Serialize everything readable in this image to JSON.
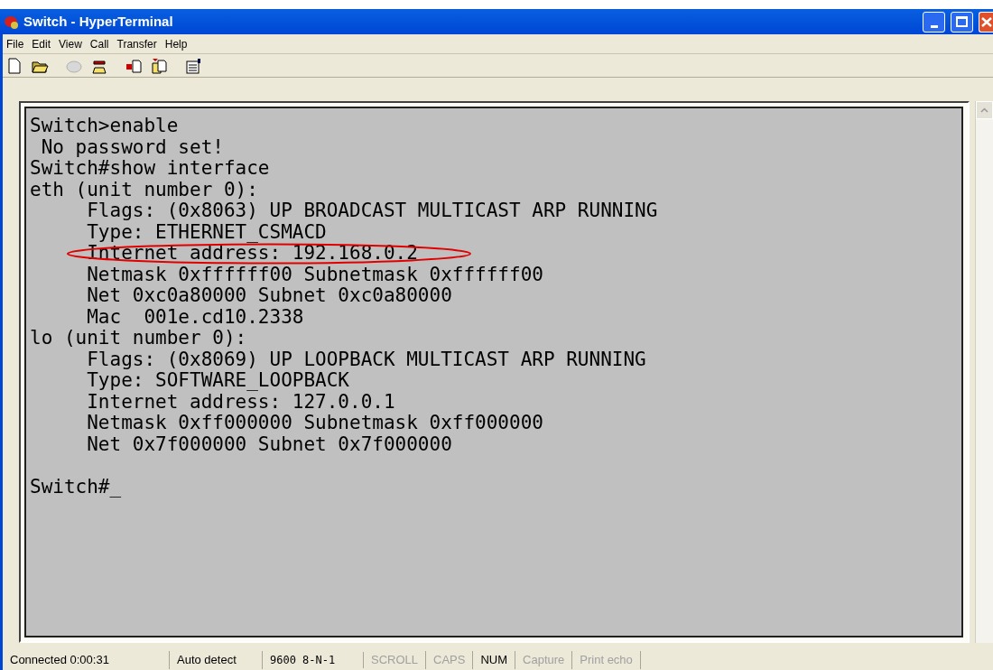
{
  "window": {
    "title": "Switch - HyperTerminal"
  },
  "menu": [
    "File",
    "Edit",
    "View",
    "Call",
    "Transfer",
    "Help"
  ],
  "toolbar": [
    {
      "kind": "new",
      "disabled": false
    },
    {
      "kind": "open",
      "disabled": false
    },
    {
      "kind": "phone",
      "disabled": true
    },
    {
      "kind": "dial",
      "disabled": false
    },
    {
      "kind": "send",
      "disabled": false
    },
    {
      "kind": "receive",
      "disabled": false
    },
    {
      "kind": "properties",
      "disabled": false
    }
  ],
  "terminal": {
    "lines": [
      {
        "text": "Switch>enable",
        "highlighted": false
      },
      {
        "text": " No password set!",
        "highlighted": false
      },
      {
        "text": "Switch#show interface",
        "highlighted": false
      },
      {
        "text": "eth (unit number 0):",
        "highlighted": false
      },
      {
        "text": "     Flags: (0x8063) UP BROADCAST MULTICAST ARP RUNNING",
        "highlighted": false
      },
      {
        "text": "     Type: ETHERNET_CSMACD",
        "highlighted": false
      },
      {
        "text": "     Internet address: 192.168.0.2",
        "highlighted": true
      },
      {
        "text": "     Netmask 0xffffff00 Subnetmask 0xffffff00",
        "highlighted": false
      },
      {
        "text": "     Net 0xc0a80000 Subnet 0xc0a80000",
        "highlighted": false
      },
      {
        "text": "     Mac  001e.cd10.2338",
        "highlighted": false
      },
      {
        "text": "lo (unit number 0):",
        "highlighted": false
      },
      {
        "text": "     Flags: (0x8069) UP LOOPBACK MULTICAST ARP RUNNING",
        "highlighted": false
      },
      {
        "text": "     Type: SOFTWARE_LOOPBACK",
        "highlighted": false
      },
      {
        "text": "     Internet address: 127.0.0.1",
        "highlighted": false
      },
      {
        "text": "     Netmask 0xff000000 Subnetmask 0xff000000",
        "highlighted": false
      },
      {
        "text": "     Net 0x7f000000 Subnet 0x7f000000",
        "highlighted": false
      }
    ],
    "prompt": "Switch#_"
  },
  "status_bar": [
    {
      "text": "Connected 0:00:31",
      "enabled": true
    },
    {
      "text": "Auto detect",
      "enabled": true
    },
    {
      "text": "9600 8-N-1",
      "enabled": true
    },
    {
      "text": "SCROLL",
      "enabled": false
    },
    {
      "text": "CAPS",
      "enabled": false
    },
    {
      "text": "NUM",
      "enabled": true
    },
    {
      "text": "Capture",
      "enabled": false
    },
    {
      "text": "Print echo",
      "enabled": false
    }
  ]
}
